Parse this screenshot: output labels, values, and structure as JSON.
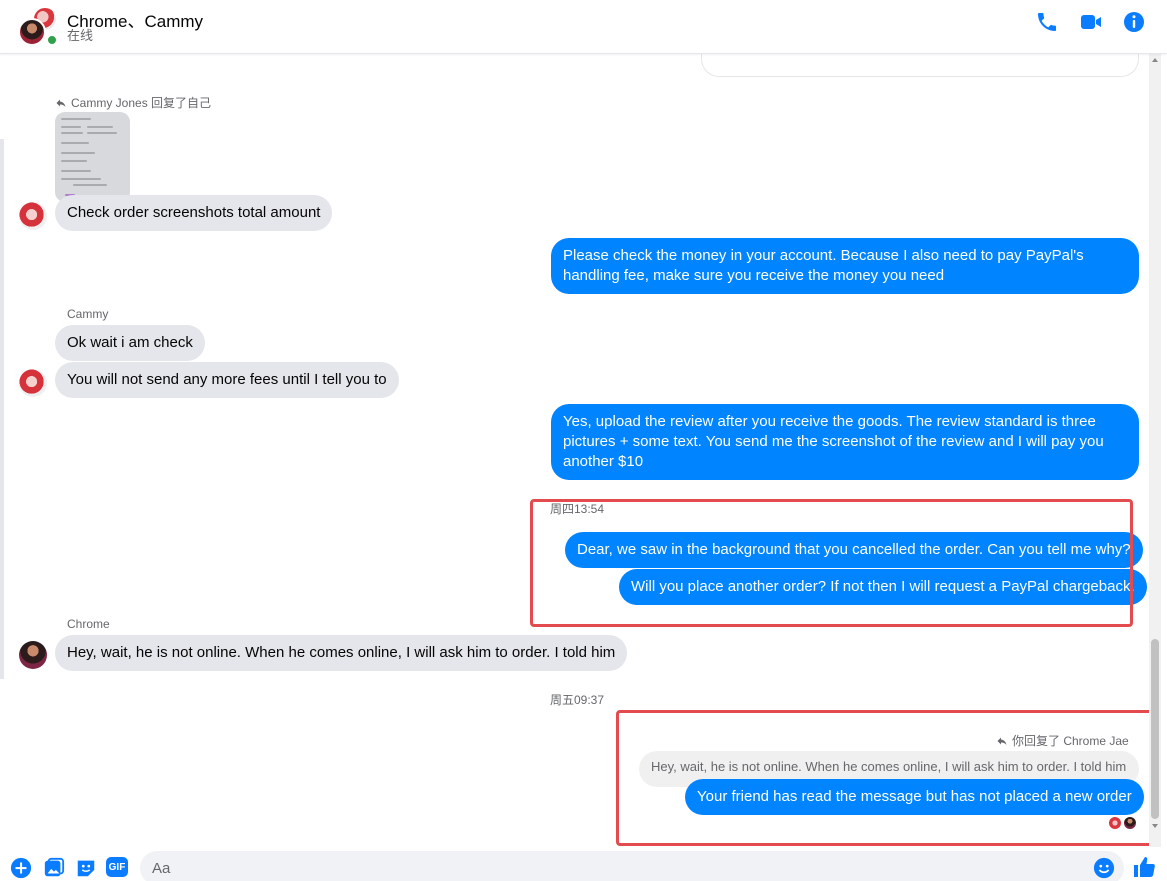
{
  "header": {
    "title": "Chrome、Cammy",
    "status": "在线"
  },
  "colors": {
    "accent": "#0084ff",
    "online": "#31a24c",
    "highlight": "#e34b4f"
  },
  "messages": {
    "reply1_label": "Cammy Jones 回复了自己",
    "m1": "Check order screenshots total amount",
    "m2": "Please check the money in your account. Because I also need to pay PayPal's handling fee, make sure you receive the money you need",
    "sender_cammy": "Cammy",
    "m3": "Ok wait i am check",
    "m4": "You will not send any more fees until I tell you to",
    "m5": "Yes, upload the review after you receive the goods. The review standard is three pictures + some text. You send me the screenshot of the review and I will pay you another $10",
    "ts1": "周四13:54",
    "m6": "Dear, we saw in the background that you cancelled the order. Can you tell me why?",
    "m7": "Will you place another order? If not then I will request a PayPal chargeback.",
    "sender_chrome": "Chrome",
    "m8": "Hey, wait, he is not online. When he comes online, I will ask him to order. I told him",
    "ts2": "周五09:37",
    "reply2_label": "你回复了 Chrome Jae",
    "quoted": "Hey, wait, he is not online. When he comes online, I will ask him to order. I told him",
    "m9": "Your friend has read the message but has not placed a new order"
  },
  "composer": {
    "placeholder": "Aa"
  },
  "icons": [
    "phone-icon",
    "video-icon",
    "info-icon",
    "plus-icon",
    "image-icon",
    "sticker-icon",
    "gif-icon",
    "emoji-icon",
    "like-icon",
    "reply-arrow-icon"
  ]
}
